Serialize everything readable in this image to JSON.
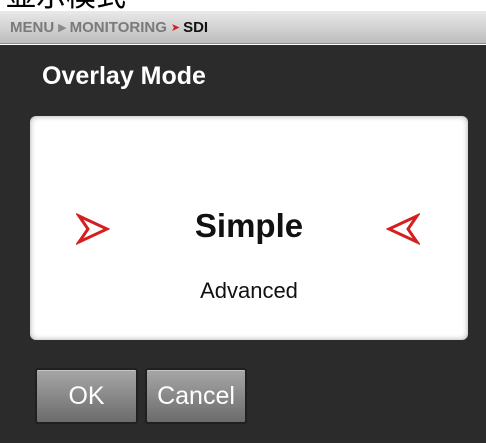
{
  "page_heading": "显示模式",
  "breadcrumb": {
    "items": [
      "MENU",
      "MONITORING",
      "SDI"
    ]
  },
  "dialog": {
    "title": "Overlay Mode",
    "options": {
      "selected": "Simple",
      "other": "Advanced"
    }
  },
  "buttons": {
    "ok_label": "OK",
    "cancel_label": "Cancel"
  },
  "colors": {
    "accent_red": "#d51f1f",
    "panel_bg": "#2b2b2b"
  },
  "icons": {
    "left_arrow": "chevron-right-icon",
    "right_arrow": "chevron-left-icon",
    "separator": "chevron-right-icon"
  }
}
